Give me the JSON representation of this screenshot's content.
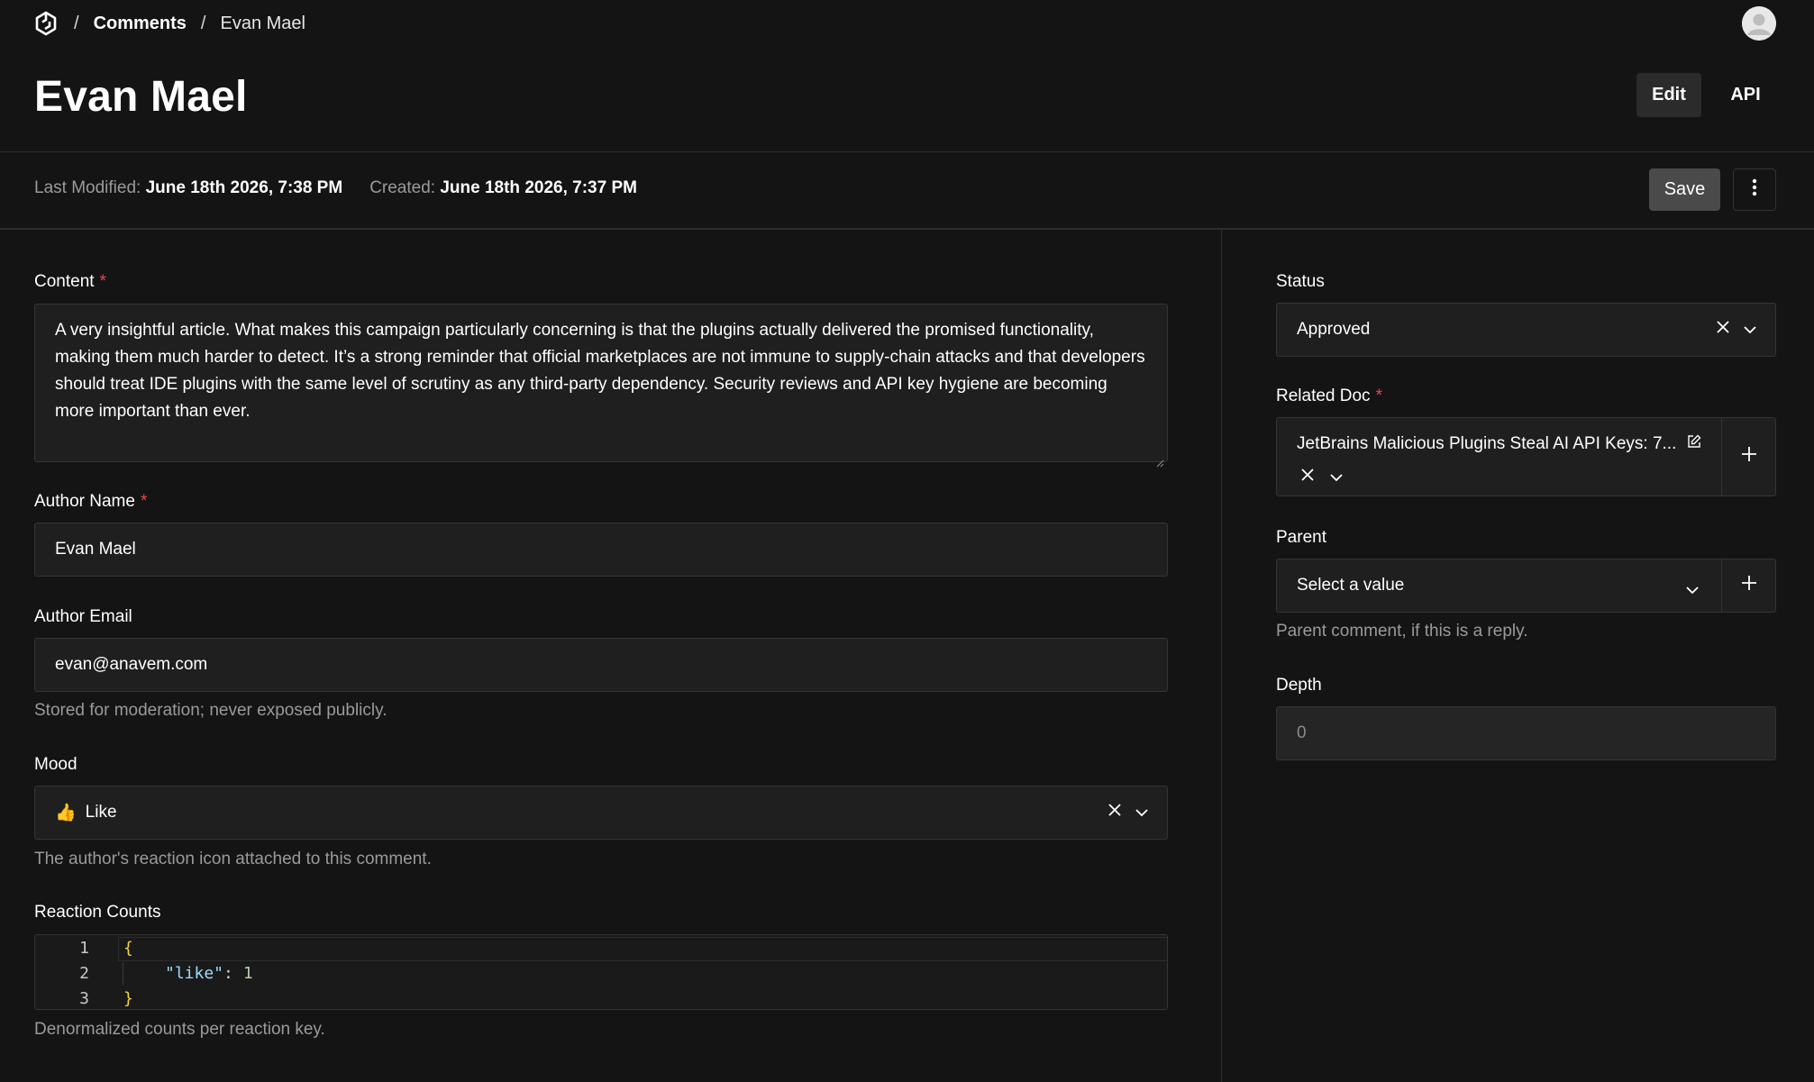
{
  "breadcrumb": {
    "separator": "/",
    "collection": "Comments",
    "current": "Evan Mael"
  },
  "page": {
    "title": "Evan Mael",
    "edit_label": "Edit",
    "api_label": "API"
  },
  "meta": {
    "modified_label": "Last Modified:",
    "modified_value": "June 18th 2026, 7:38 PM",
    "created_label": "Created:",
    "created_value": "June 18th 2026, 7:37 PM",
    "save_label": "Save"
  },
  "fields": {
    "content": {
      "label": "Content",
      "required": "*",
      "value": "A very insightful article. What makes this campaign particularly concerning is that the plugins actually delivered the promised functionality, making them much harder to detect. It’s a strong reminder that official marketplaces are not immune to supply-chain attacks and that developers should treat IDE plugins with the same level of scrutiny as any third-party dependency. Security reviews and API key hygiene are becoming more important than ever."
    },
    "author_name": {
      "label": "Author Name",
      "required": "*",
      "value": "Evan Mael"
    },
    "author_email": {
      "label": "Author Email",
      "value": "evan@anavem.com",
      "help": "Stored for moderation; never exposed publicly."
    },
    "mood": {
      "label": "Mood",
      "emoji": "👍",
      "value": "Like",
      "help": "The author's reaction icon attached to this comment."
    },
    "reaction_counts": {
      "label": "Reaction Counts",
      "lines": [
        {
          "num": "1",
          "open": "{"
        },
        {
          "num": "2",
          "key": "\"like\"",
          "colon": ":",
          "value": "1"
        },
        {
          "num": "3",
          "close": "}"
        }
      ],
      "help": "Denormalized counts per reaction key."
    },
    "status": {
      "label": "Status",
      "value": "Approved"
    },
    "related_doc": {
      "label": "Related Doc",
      "required": "*",
      "value": "JetBrains Malicious Plugins Steal AI API Keys: 7..."
    },
    "parent": {
      "label": "Parent",
      "placeholder": "Select a value",
      "help": "Parent comment, if this is a reply."
    },
    "depth": {
      "label": "Depth",
      "placeholder": "0"
    }
  },
  "icons": {
    "logo": "payload-logo-icon",
    "avatar": "user-avatar-icon",
    "more": "vertical-dots-icon",
    "clear": "close-icon",
    "chevron": "chevron-down-icon",
    "add": "plus-icon",
    "edit_doc": "edit-document-icon"
  },
  "colors": {
    "background": "#141414",
    "field": "#1f1f1f",
    "required": "#e5484d"
  }
}
